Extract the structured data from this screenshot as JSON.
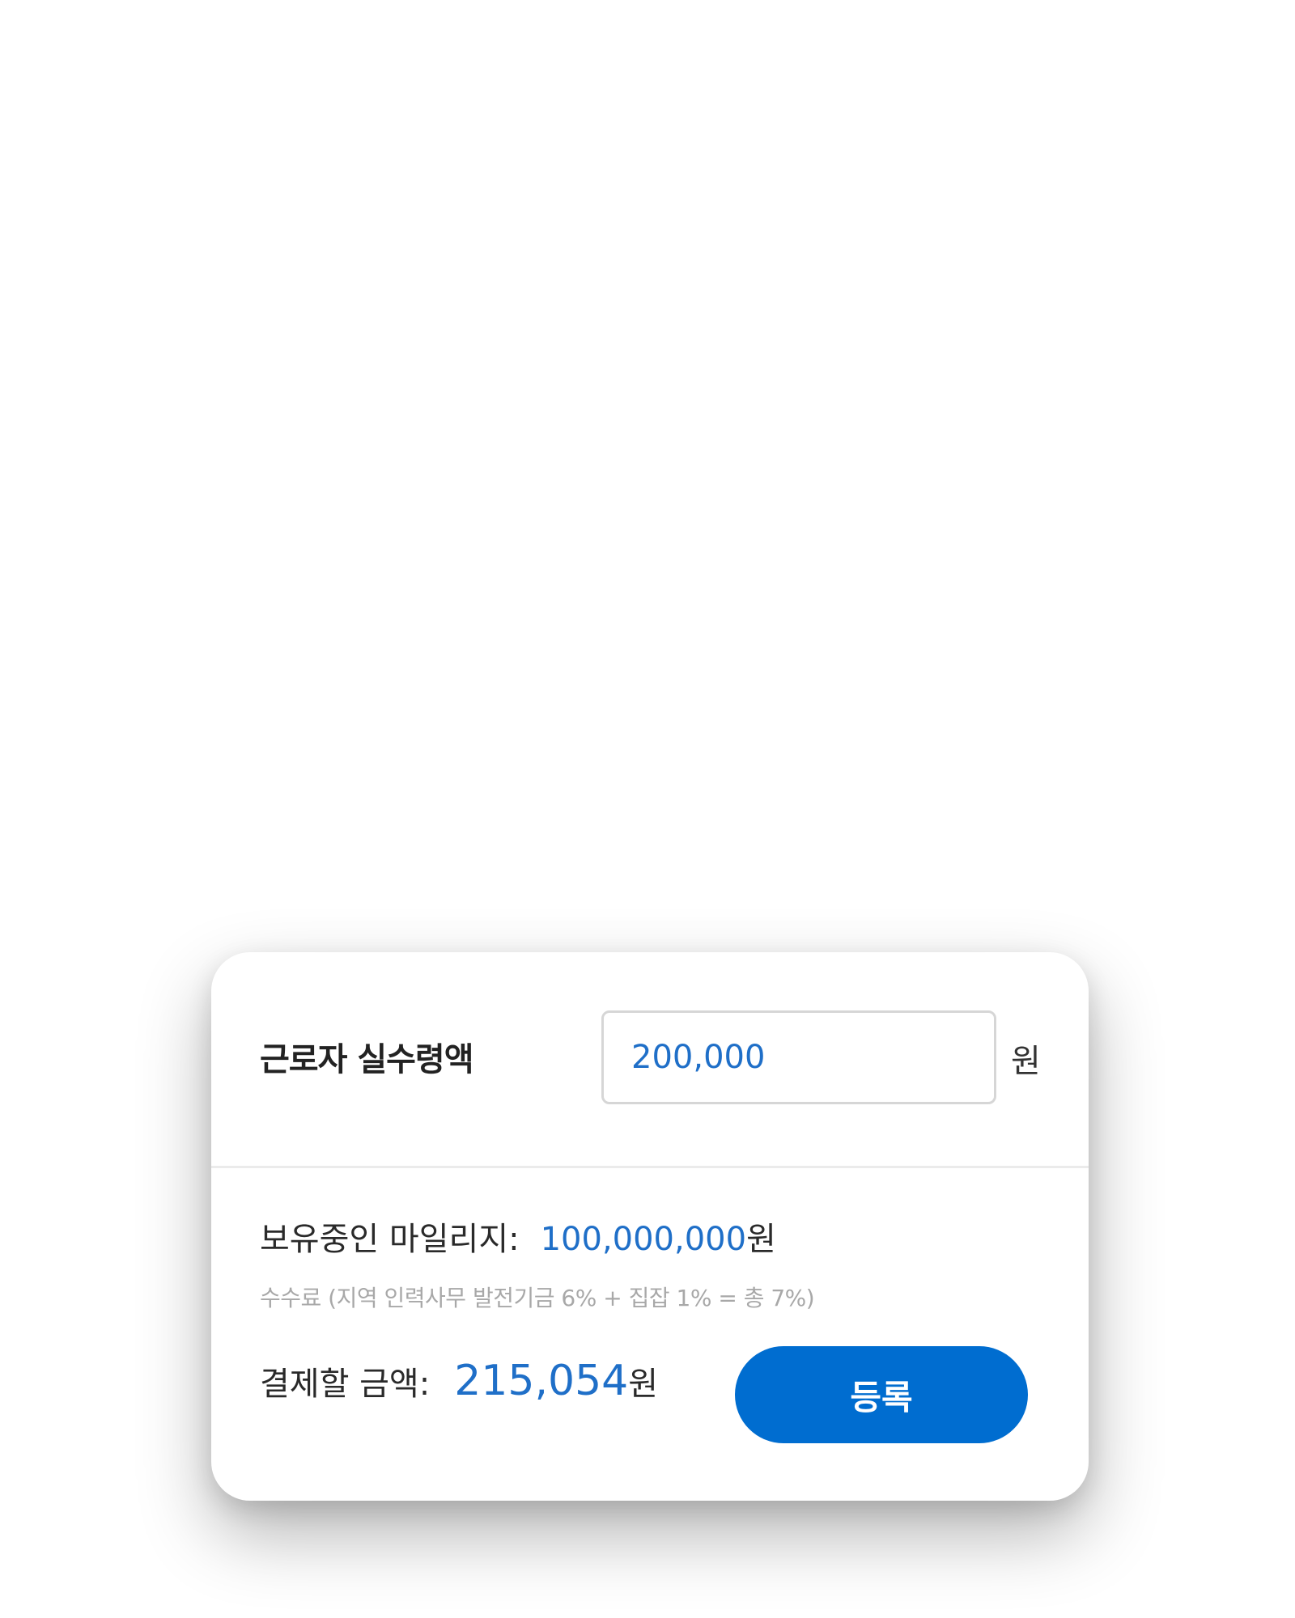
{
  "wage": {
    "label": "근로자 실수령액",
    "input_value": "200,000",
    "unit": "원"
  },
  "mileage": {
    "label": "보유중인 마일리지:",
    "value": "100,000,000",
    "unit": "원"
  },
  "fee_note": "수수료 (지역 인력사무 발전기금 6% + 집잡 1% = 총 7%)",
  "payment": {
    "label": "결제할 금액:",
    "amount": "215,054",
    "unit": "원"
  },
  "register_button": {
    "label": "등록"
  },
  "colors": {
    "accent": "#1f6fc8",
    "button": "#006dd0",
    "muted_text": "#a8a8a8"
  }
}
